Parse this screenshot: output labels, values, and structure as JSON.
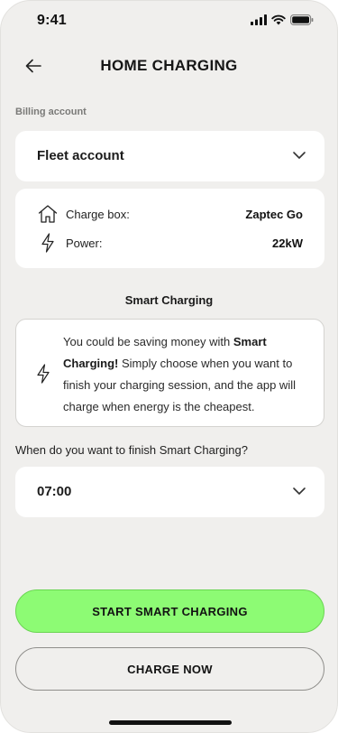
{
  "status_bar": {
    "time": "9:41"
  },
  "header": {
    "title": "HOME CHARGING"
  },
  "billing": {
    "label": "Billing account",
    "selected": "Fleet account"
  },
  "charger_info": {
    "charge_box_label": "Charge box:",
    "charge_box_value": "Zaptec Go",
    "power_label": "Power:",
    "power_value": "22kW"
  },
  "smart_charging": {
    "title": "Smart Charging",
    "notice_part1": "You could be saving money with ",
    "notice_bold": "Smart Charging!",
    "notice_part2": " Simply choose when you want to finish your charging session, and the app will charge when energy is the cheapest."
  },
  "finish_time": {
    "question": "When do you want to finish Smart Charging?",
    "selected": "07:00"
  },
  "actions": {
    "start_label": "START SMART CHARGING",
    "charge_now_label": "CHARGE NOW"
  },
  "colors": {
    "background": "#f0efed",
    "primary_button": "#8dfb74",
    "card": "#ffffff"
  },
  "icons": [
    "arrow-left-icon",
    "chevron-down-icon",
    "house-icon",
    "lightning-icon",
    "signal-icon",
    "wifi-icon",
    "battery-icon"
  ]
}
